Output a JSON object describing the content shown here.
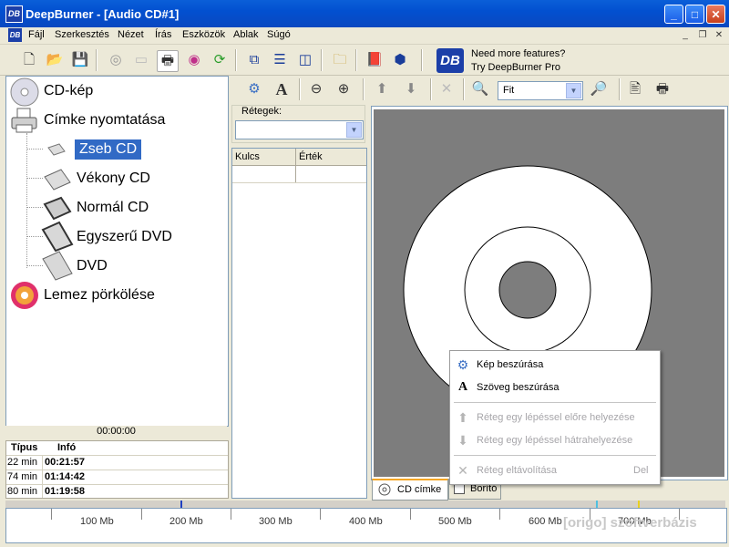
{
  "window": {
    "title": "DeepBurner - [Audio CD#1]",
    "app_logo": "DB"
  },
  "menu": [
    "Fájl",
    "Szerkesztés",
    "Nézet",
    "Írás",
    "Eszközök",
    "Ablak",
    "Súgó"
  ],
  "promo": {
    "line1": "Need more features?",
    "line2": "Try DeepBurner Pro"
  },
  "tree": {
    "items": [
      {
        "label": "CD-kép",
        "icon": "cd-icon"
      },
      {
        "label": "Címke nyomtatása",
        "icon": "printer-icon"
      },
      {
        "label": "Zseb CD",
        "icon": "pocket-cd-case-icon",
        "selected": true
      },
      {
        "label": "Vékony CD",
        "icon": "slim-cd-case-icon"
      },
      {
        "label": "Normál CD",
        "icon": "normal-cd-case-icon"
      },
      {
        "label": "Egyszerű DVD",
        "icon": "dvd-case-icon"
      },
      {
        "label": "DVD",
        "icon": "dvd-case-icon"
      },
      {
        "label": "Lemez pörkölése",
        "icon": "burn-disc-icon"
      }
    ]
  },
  "status": {
    "time": "00:00:00",
    "headers": {
      "type": "Típus",
      "info": "Infó"
    },
    "rows": [
      {
        "type": "22 min",
        "info": "00:21:57"
      },
      {
        "type": "74 min",
        "info": "01:14:42"
      },
      {
        "type": "80 min",
        "info": "01:19:58"
      }
    ]
  },
  "layers": {
    "label": "Rétegek:",
    "col_key": "Kulcs",
    "col_value": "Érték"
  },
  "zoom": {
    "value": "Fit"
  },
  "tabs": [
    {
      "label": "CD címke",
      "active": true
    },
    {
      "label": "Borító",
      "active": false
    }
  ],
  "context_menu": [
    {
      "label": "Kép beszúrása",
      "disabled": false,
      "icon": "insert-image-icon"
    },
    {
      "label": "Szöveg beszúrása",
      "disabled": false,
      "icon": "insert-text-icon"
    },
    {
      "label": "Réteg egy lépéssel előre helyezése",
      "disabled": true,
      "icon": "arrow-up-icon"
    },
    {
      "label": "Réteg egy lépéssel hátrahelyezése",
      "disabled": true,
      "icon": "arrow-down-icon"
    },
    {
      "label": "Réteg eltávolítása",
      "shortcut": "Del",
      "disabled": true,
      "icon": "delete-icon"
    }
  ],
  "ruler": {
    "labels": [
      "100 Mb",
      "200 Mb",
      "300 Mb",
      "400 Mb",
      "500 Mb",
      "600 Mb",
      "700 Mb"
    ]
  },
  "watermark": "[origo] szoftverbázis",
  "colors": {
    "title_blue": "#0a5fd8",
    "selection": "#316ac5",
    "canvas_gray": "#7d7d7d"
  }
}
